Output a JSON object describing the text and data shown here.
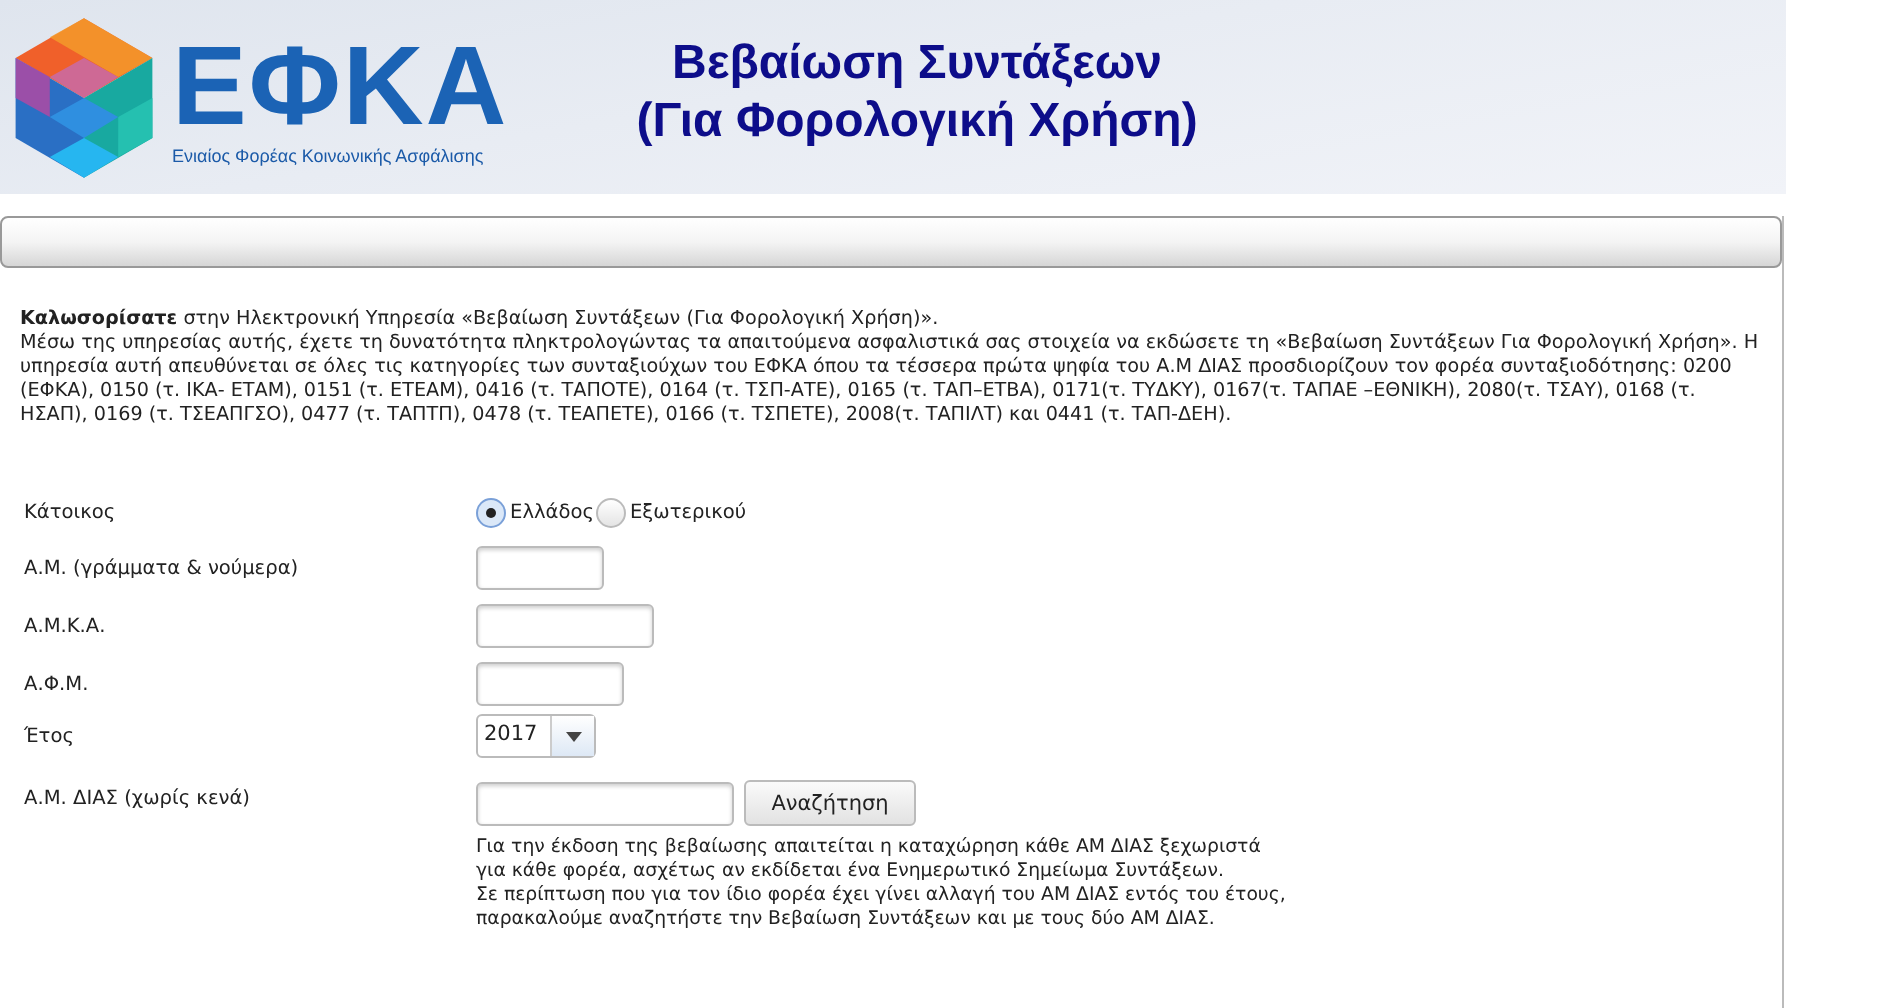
{
  "header": {
    "logo_text": "ΕΦΚΑ",
    "logo_subtitle": "Ενιαίος Φορέας Κοινωνικής Ασφάλισης",
    "title_lines": [
      "Βεβαίωση Συντάξεων",
      "(Για Φορολογική Χρήση)"
    ]
  },
  "intro": [
    "**Καλωσορίσατε** στην Ηλεκτρονική Υπηρεσία «Βεβαίωση Συντάξεων (Για Φορολογική Χρήση)».",
    "Μέσω της υπηρεσίας αυτής, έχετε τη δυνατότητα πληκτρολογώντας τα απαιτούμενα ασφαλιστικά σας στοιχεία να εκδώσετε τη «Βεβαίωση Συντάξεων Για Φορολογική Χρήση». Η υπηρεσία αυτή απευθύνεται σε όλες τις κατηγορίες των συνταξιούχων του ΕΦΚΑ όπου τα τέσσερα πρώτα ψηφία του Α.Μ ΔΙΑΣ προσδιορίζουν τον φορέα συνταξιοδότησης: 0200 (ΕΦΚΑ), 0150 (τ. ΙΚΑ- ΕΤΑΜ), 0151 (τ. ΕΤΕΑΜ), 0416 (τ. ΤΑΠΟΤΕ), 0164 (τ. ΤΣΠ-ΑΤΕ), 0165 (τ. ΤΑΠ–ΕΤΒΑ), 0171(τ. ΤΥΔΚΥ), 0167(τ. ΤΑΠΑΕ –ΕΘΝΙΚΗ), 2080(τ. ΤΣΑΥ), 0168 (τ. ΗΣΑΠ), 0169 (τ. ΤΣΕΑΠΓΣΟ), 0477 (τ. ΤΑΠΤΠ), 0478 (τ. ΤΕΑΠΕΤΕ), 0166 (τ. ΤΣΠΕΤΕ), 2008(τ. ΤΑΠΙΛΤ) και 0441 (τ. ΤΑΠ-ΔΕΗ)."
  ],
  "form": {
    "rows": [
      {
        "kind": "radio",
        "label": "Κάτοικος",
        "options": [
          {
            "label": "Ελλάδος",
            "selected": true
          },
          {
            "label": "Εξωτερικού",
            "selected": false
          }
        ]
      },
      {
        "kind": "text",
        "label": "Α.Μ. (γράμματα & νούμερα)"
      },
      {
        "kind": "text",
        "label": "Α.Μ.Κ.Α."
      },
      {
        "kind": "text",
        "label": "Α.Φ.Μ."
      },
      {
        "kind": "select",
        "label": "Έτος",
        "value": "2017"
      },
      {
        "kind": "search",
        "label": "Α.Μ. ΔΙΑΣ (χωρίς κενά)",
        "button": "Αναζήτηση",
        "note_lines": [
          "Για την έκδοση της βεβαίωσης απαιτείται η καταχώρηση κάθε ΑΜ ΔΙΑΣ ξεχωριστά",
          "για κάθε φορέα, ασχέτως αν εκδίδεται ένα Ενημερωτικό Σημείωμα Συντάξεων.",
          "Σε περίπτωση που για τον ίδιο φορέα έχει γίνει αλλαγή του ΑΜ ΔΙΑΣ εντός του έτους,",
          "παρακαλούμε αναζητήστε την Βεβαίωση Συντάξεων και με τους δύο ΑΜ ΔΙΑΣ."
        ]
      }
    ]
  }
}
